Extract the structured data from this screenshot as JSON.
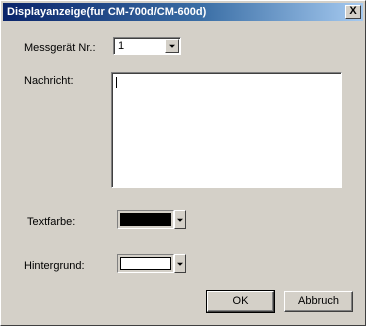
{
  "window": {
    "title": "Displayanzeige(fur CM-700d/CM-600d)",
    "close_glyph": "X"
  },
  "device": {
    "label": "Messgerät Nr.:",
    "value": "1"
  },
  "message": {
    "label": "Nachricht:",
    "value": ""
  },
  "text_color": {
    "label": "Textfarbe:",
    "color": "#000000"
  },
  "background_color": {
    "label": "Hintergrund:",
    "color": "#ffffff"
  },
  "buttons": {
    "ok_label": "OK",
    "cancel_label": "Abbruch"
  },
  "icons": {
    "dropdown": "chevron-down-icon",
    "close": "close-icon"
  }
}
